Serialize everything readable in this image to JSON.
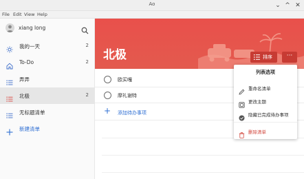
{
  "window": {
    "title": "Ao"
  },
  "menu": {
    "file": "File",
    "edit": "Edit",
    "view": "View",
    "help": "Help"
  },
  "user": {
    "name": "xiang long"
  },
  "sidebar": {
    "items": [
      {
        "label": "我的一天",
        "count": "2",
        "icon": "sun-icon"
      },
      {
        "label": "To-Do",
        "count": "2",
        "icon": "home-icon"
      },
      {
        "label": "弄弄",
        "count": "",
        "icon": "list-icon"
      },
      {
        "label": "北极",
        "count": "2",
        "icon": "list-icon"
      },
      {
        "label": "无标题清单",
        "count": "",
        "icon": "list-icon"
      }
    ],
    "new_list": "新建清单"
  },
  "main": {
    "title": "北极",
    "sort_label": "排序",
    "more_label": "···",
    "tasks": [
      {
        "text": "欧买嘎"
      },
      {
        "text": "摩礼谢特"
      }
    ],
    "add_task": "添加待办事项"
  },
  "dropdown": {
    "title": "列表选项",
    "items": [
      {
        "label": "重命名清单",
        "icon": "pencil-icon"
      },
      {
        "label": "更改主题",
        "icon": "palette-icon"
      },
      {
        "label": "隐藏已完成待办事项",
        "icon": "check-circle-icon"
      },
      {
        "label": "删除清单",
        "icon": "trash-icon"
      }
    ]
  },
  "colors": {
    "accent": "#e9504b",
    "link": "#2f6fd3",
    "danger": "#d1453b"
  }
}
